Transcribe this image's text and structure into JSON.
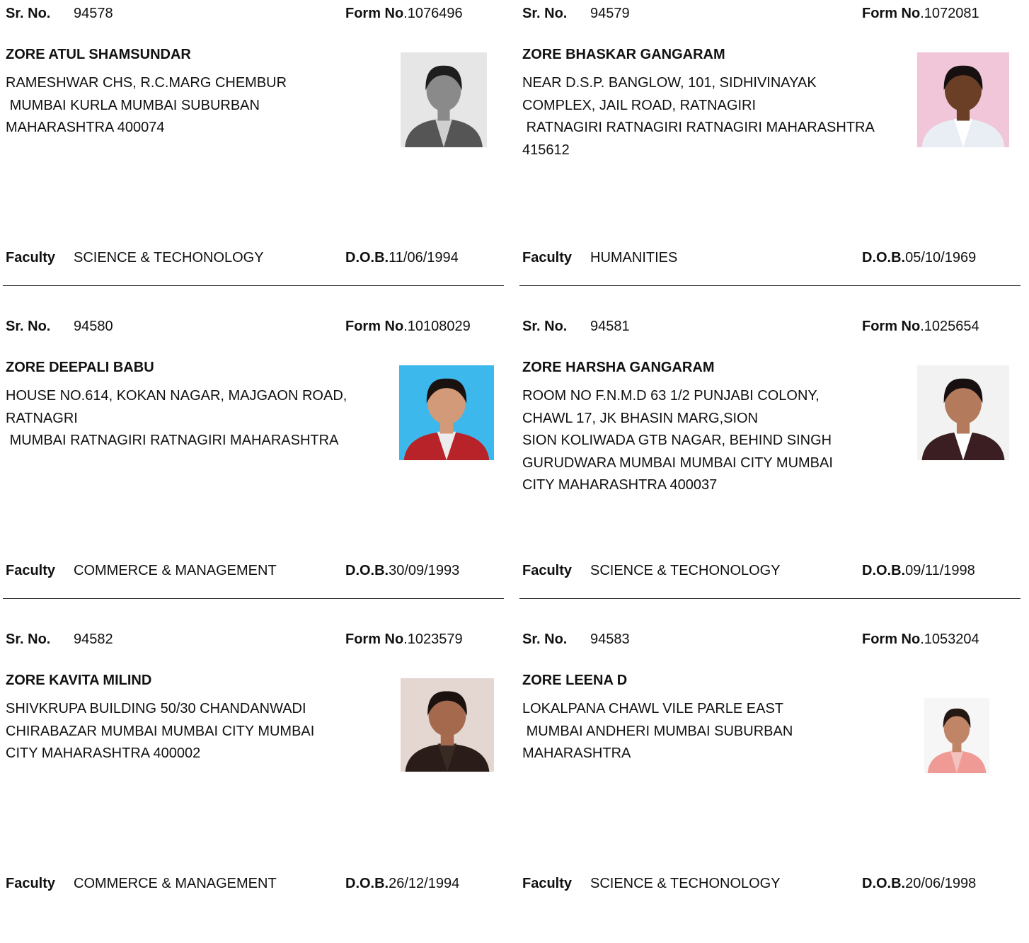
{
  "labels": {
    "sr": "Sr. No.",
    "form": "Form No",
    "faculty": "Faculty",
    "dob": "D.O.B."
  },
  "records": [
    {
      "sr_no": "94578",
      "form_no": ".1076496",
      "name": "ZORE ATUL SHAMSUNDAR",
      "address": "RAMESHWAR CHS, R.C.MARG CHEMBUR\n MUMBAI KURLA MUMBAI SUBURBAN\nMAHARASHTRA 400074",
      "faculty": "SCIENCE & TECHONOLOGY",
      "dob": "11/06/1994",
      "photo": {
        "bg": "#e6e6e6",
        "skin": "#8a8a8a",
        "hair": "#1e1e1e",
        "clothes": "#555555",
        "shirt": "#cfcfcf"
      }
    },
    {
      "sr_no": "94579",
      "form_no": ".1072081",
      "name": "ZORE BHASKAR GANGARAM",
      "address": "NEAR D.S.P. BANGLOW, 101, SIDHIVINAYAK\nCOMPLEX, JAIL ROAD, RATNAGIRI\n RATNAGIRI RATNAGIRI RATNAGIRI MAHARASHTRA\n415612",
      "faculty": "HUMANITIES",
      "dob": "05/10/1969",
      "photo": {
        "bg": "#f1c6d8",
        "skin": "#6b3f26",
        "hair": "#161010",
        "clothes": "#e9eef4",
        "shirt": "#ffffff"
      }
    },
    {
      "sr_no": "94580",
      "form_no": ".10108029",
      "name": "ZORE DEEPALI BABU",
      "address": "HOUSE NO.614, KOKAN NAGAR, MAJGAON ROAD,\nRATNAGRI\n MUMBAI RATNAGIRI RATNAGIRI MAHARASHTRA",
      "faculty": "COMMERCE & MANAGEMENT",
      "dob": "30/09/1993",
      "photo": {
        "bg": "#3db8ec",
        "skin": "#d29a78",
        "hair": "#1a1210",
        "clothes": "#b8232a",
        "shirt": "#ececec"
      }
    },
    {
      "sr_no": "94581",
      "form_no": ".1025654",
      "name": "ZORE HARSHA GANGARAM",
      "address": "ROOM NO F.N.M.D 63 1/2 PUNJABI COLONY,\nCHAWL 17, JK BHASIN MARG,SION\nSION KOLIWADA GTB NAGAR, BEHIND SINGH\nGURUDWARA MUMBAI MUMBAI CITY MUMBAI\nCITY MAHARASHTRA 400037",
      "faculty": "SCIENCE & TECHONOLOGY",
      "dob": "09/11/1998",
      "photo": {
        "bg": "#f2f2f2",
        "skin": "#b47a5c",
        "hair": "#181010",
        "clothes": "#3a1e22",
        "shirt": "#ffffff"
      }
    },
    {
      "sr_no": "94582",
      "form_no": ".1023579",
      "name": "ZORE KAVITA MILIND",
      "address": "SHIVKRUPA BUILDING 50/30 CHANDANWADI\nCHIRABAZAR MUMBAI MUMBAI CITY MUMBAI\nCITY MAHARASHTRA 400002",
      "faculty": "COMMERCE & MANAGEMENT",
      "dob": "26/12/1994",
      "photo": {
        "bg": "#e4d7d2",
        "skin": "#a56a4e",
        "hair": "#1b120f",
        "clothes": "#2a1c18",
        "shirt": "#3a2a24"
      }
    },
    {
      "sr_no": "94583",
      "form_no": ".1053204",
      "name": "ZORE LEENA D",
      "address": "LOKALPANA CHAWL VILE PARLE EAST\n MUMBAI ANDHERI MUMBAI SUBURBAN\nMAHARASHTRA",
      "faculty": "SCIENCE & TECHONOLOGY",
      "dob": "20/06/1998",
      "photo": {
        "bg": "#f6f6f6",
        "skin": "#c08466",
        "hair": "#241814",
        "clothes": "#ef9a94",
        "shirt": "#f3c2be"
      }
    }
  ]
}
